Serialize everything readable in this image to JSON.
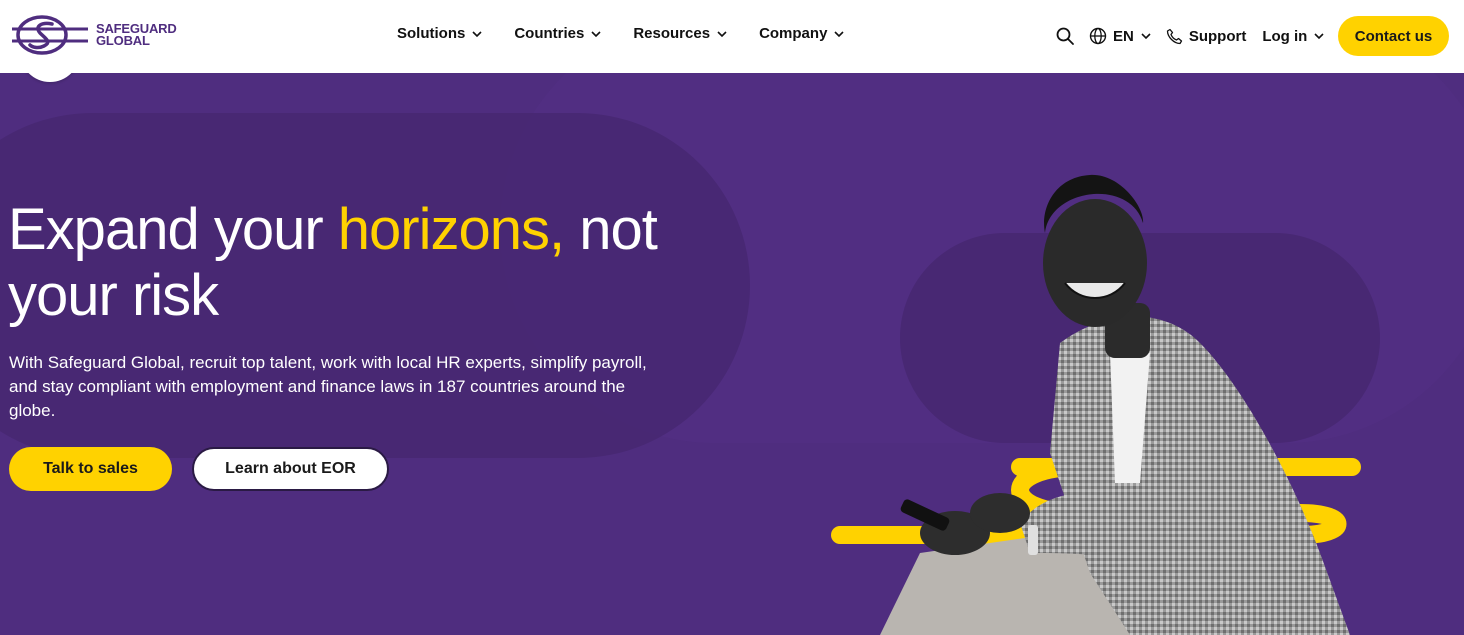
{
  "brand": {
    "name_line1": "SAFEGUARD",
    "name_line2": "GLOBAL",
    "color": "#4f2d7f",
    "accent": "#ffd200"
  },
  "nav": {
    "items": [
      {
        "label": "Solutions"
      },
      {
        "label": "Countries"
      },
      {
        "label": "Resources"
      },
      {
        "label": "Company"
      }
    ]
  },
  "header_right": {
    "search_icon": "search-icon",
    "language": "EN",
    "support": "Support",
    "login": "Log in",
    "contact": "Contact us"
  },
  "hero": {
    "headline_part1": "Expand your ",
    "headline_highlight": "horizons,",
    "headline_part2": " not your risk",
    "subtext": "With Safeguard Global, recruit top talent, work with local HR experts, simplify payroll, and stay compliant with employment and finance laws in 187 countries around the globe.",
    "cta_primary": "Talk to sales",
    "cta_secondary": "Learn about EOR"
  }
}
